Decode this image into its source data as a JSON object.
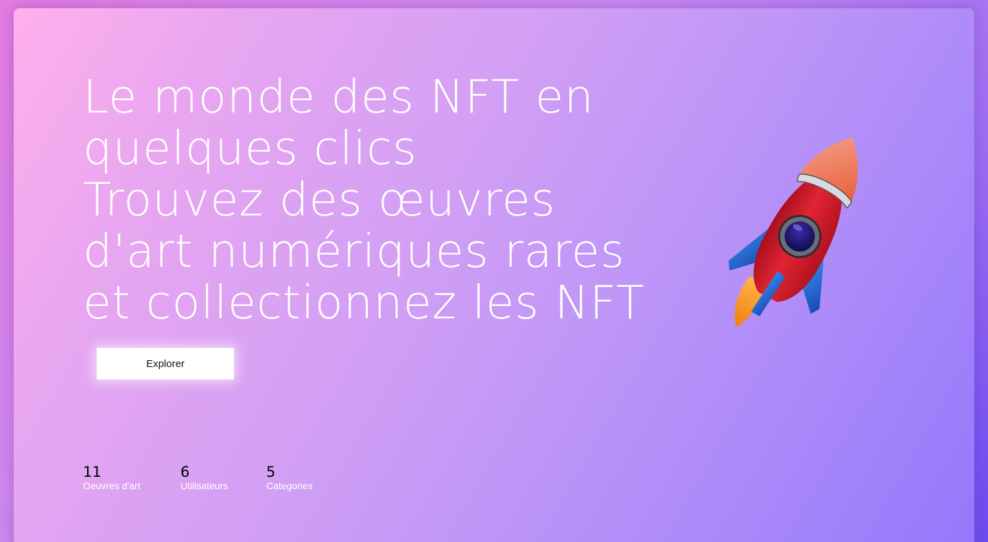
{
  "hero": {
    "headline_line1": "Le monde des NFT en quelques clics",
    "headline_line2": "Trouvez des œuvres d'art numériques rares et collectionnez les NFT",
    "cta_label": "Explorer"
  },
  "stats": [
    {
      "value": "11",
      "label": "Oeuvres d'art"
    },
    {
      "value": "6",
      "label": "Utilisateurs"
    },
    {
      "value": "5",
      "label": "Categories"
    }
  ],
  "illustration": {
    "name": "rocket-icon"
  },
  "colors": {
    "background_start": "#e27ce0",
    "background_end": "#6b4cf0",
    "card_start": "#ffb0ec",
    "card_end": "#9677fb",
    "text": "#ffffff",
    "stat_value": "#000000",
    "button_bg": "#ffffff",
    "rocket_body": "#d41c2c",
    "rocket_nose": "#f0846a",
    "rocket_fins": "#1e6fd6",
    "rocket_flame": "#f5a623"
  }
}
